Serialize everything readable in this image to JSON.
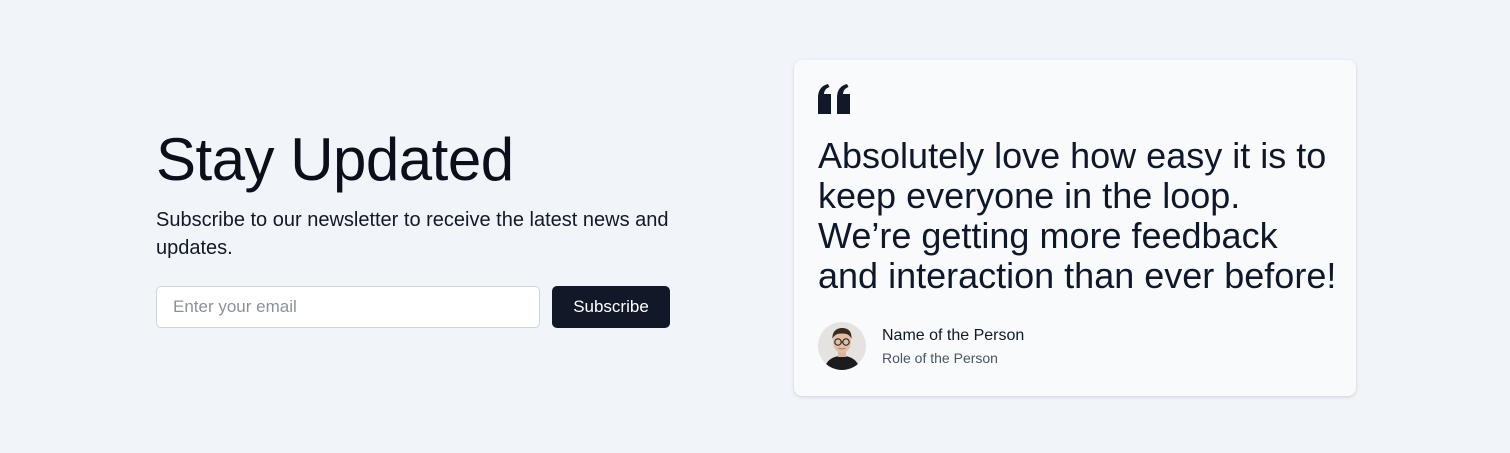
{
  "newsletter": {
    "title": "Stay Updated",
    "subtitle": "Subscribe to our newsletter to receive the latest news and updates.",
    "email_placeholder": "Enter your email",
    "email_value": "",
    "subscribe_label": "Subscribe"
  },
  "testimonial": {
    "icon": "quote-icon",
    "quote": "Absolutely love how easy it is to keep everyone in the loop. We’re getting more feedback and interaction than ever before!",
    "author_name": "Name of the Person",
    "author_role": "Role of the Person",
    "avatar_icon": "avatar"
  },
  "colors": {
    "background": "#f1f4f8",
    "card_background": "#f8fafc",
    "button_background": "#111827",
    "button_text": "#ffffff",
    "text_primary": "#111827",
    "text_secondary": "#4b5563"
  }
}
